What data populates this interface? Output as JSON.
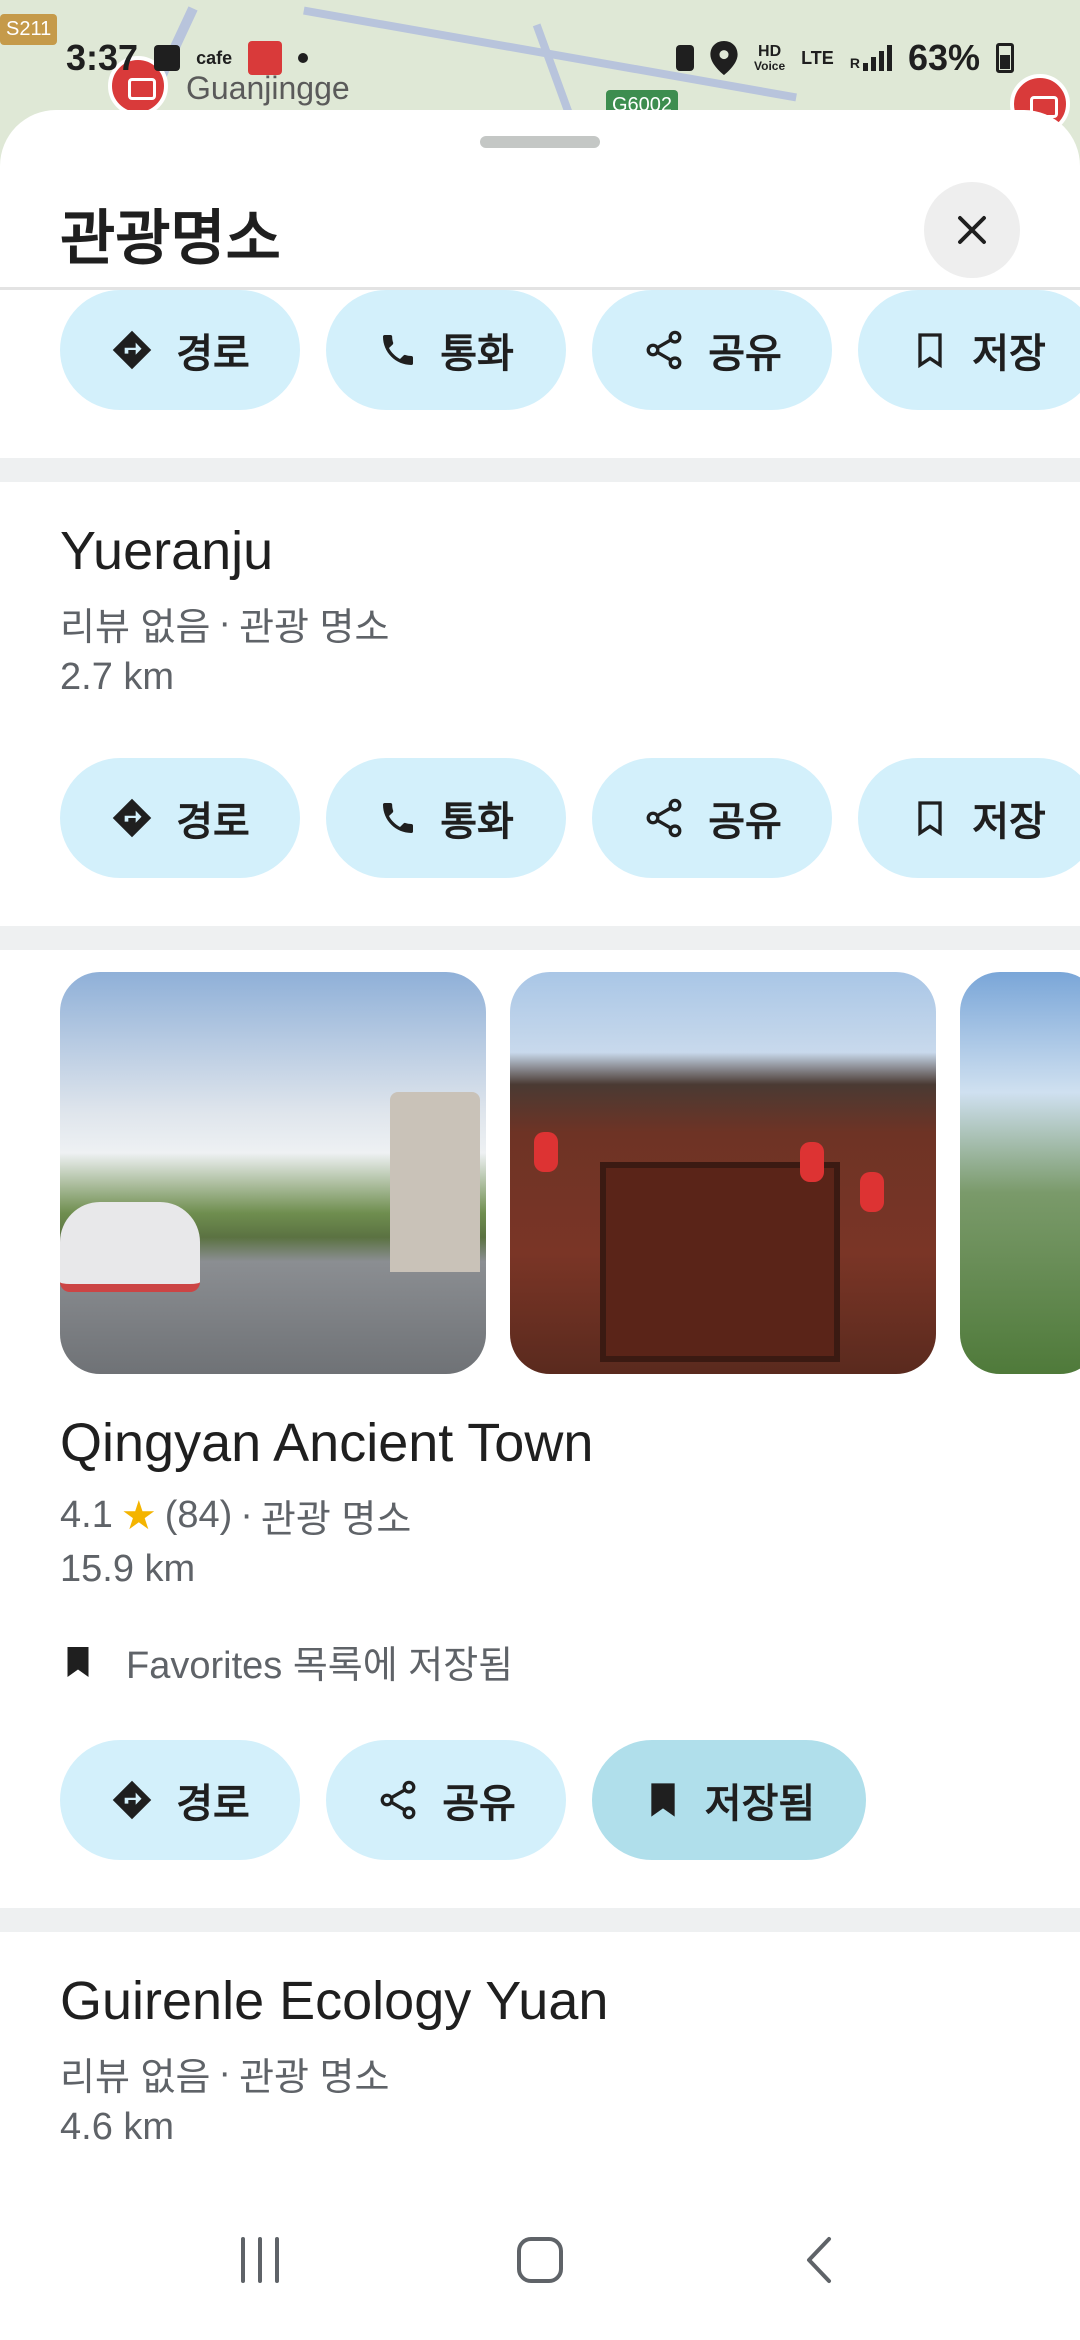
{
  "status_bar": {
    "time": "3:37",
    "cafe_label": "cafe",
    "hd_label": "HD",
    "voice_label": "Voice",
    "lte_label": "LTE",
    "r_label": "R",
    "battery": "63%"
  },
  "map": {
    "road_badge_left": "S211",
    "road_badge_center": "G6002",
    "place_label": "Guanjingge"
  },
  "sheet": {
    "title": "관광명소",
    "close_icon": "close-icon"
  },
  "actions": {
    "directions": "경로",
    "call": "통화",
    "share": "공유",
    "save": "저장",
    "saved": "저장됨"
  },
  "places": [
    {
      "name": "Yueranju",
      "reviews": "리뷰 없음",
      "category": "관광 명소",
      "distance": "2.7 km"
    },
    {
      "name": "Qingyan Ancient Town",
      "rating": "4.1",
      "review_count": "(84)",
      "category": "관광 명소",
      "distance": "15.9 km",
      "saved_note": "Favorites 목록에 저장됨"
    },
    {
      "name": "Guirenle Ecology Yuan",
      "reviews": "리뷰 없음",
      "category": "관광 명소",
      "distance": "4.6 km"
    }
  ],
  "meta_separator": "·",
  "colors": {
    "action_bg": "#d3f0fb",
    "saved_bg": "#b0dfeb",
    "star": "#f4b400",
    "separator": "#eef0f1"
  }
}
